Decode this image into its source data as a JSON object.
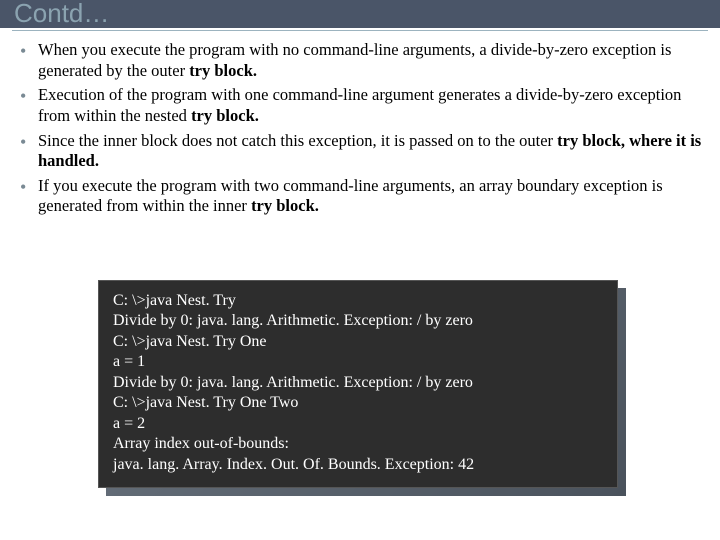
{
  "title": "Contd…",
  "bullets": [
    {
      "pre": "When you execute the program with no command-line arguments, a divide-by-zero exception is generated by the outer ",
      "bold": "try block.",
      "post": ""
    },
    {
      "pre": "Execution of the program with one command-line argument generates a divide-by-zero exception from within the nested ",
      "bold": "try block.",
      "post": ""
    },
    {
      "pre": "Since the inner block does not catch this exception, it is passed on to the outer ",
      "bold": "try block, where it is handled.",
      "post": ""
    },
    {
      "pre": "If you execute the program with two command-line arguments, an array boundary exception is generated from within the inner ",
      "bold": "try block.",
      "post": ""
    }
  ],
  "console": [
    "C: \\>java Nest. Try",
    "Divide by 0: java. lang. Arithmetic. Exception: / by zero",
    "C: \\>java Nest. Try One",
    "a = 1",
    "Divide by 0: java. lang. Arithmetic. Exception: / by zero",
    "C: \\>java Nest. Try One Two",
    "a = 2",
    "Array index out-of-bounds:",
    "java. lang. Array. Index. Out. Of. Bounds. Exception: 42"
  ]
}
